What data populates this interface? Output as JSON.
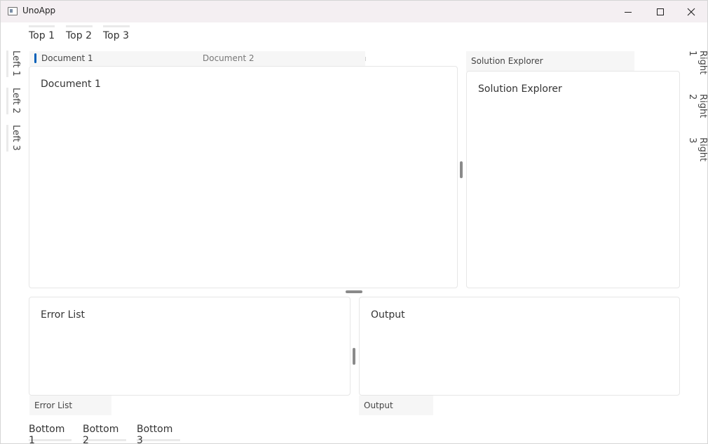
{
  "window": {
    "title": "UnoApp",
    "icon": "app-window-icon",
    "controls": [
      "minimize-icon",
      "maximize-icon",
      "close-icon"
    ]
  },
  "top_tabs": [
    "Top 1",
    "Top 2",
    "Top 3"
  ],
  "left_tabs": [
    "Left 1",
    "Left 2",
    "Left 3"
  ],
  "right_tabs": [
    "Right 1",
    "Right 2",
    "Right 3"
  ],
  "bottom_tabs": [
    "Bottom 1",
    "Bottom 2",
    "Bottom 3"
  ],
  "document_tabs": [
    {
      "label": "Document 1",
      "active": true
    },
    {
      "label": "Document 2",
      "active": false
    }
  ],
  "document_content": "Document 1",
  "solution_explorer": {
    "tab": "Solution Explorer",
    "content": "Solution Explorer"
  },
  "error_list": {
    "tab": "Error List",
    "content": "Error List"
  },
  "output": {
    "tab": "Output",
    "content": "Output"
  },
  "colors": {
    "accent": "#005fb8",
    "titlebar": "#f4eff2",
    "tab_background": "#f6f6f6",
    "panel_border": "#e6e6e6"
  }
}
